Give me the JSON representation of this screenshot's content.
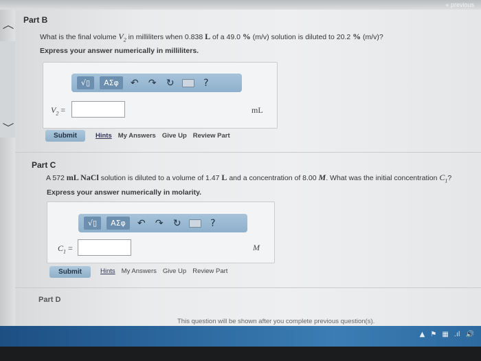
{
  "nav": {
    "previous_link": "« previous"
  },
  "partB": {
    "label": "Part B",
    "q_pre": "What is the final volume ",
    "q_var_main": "V",
    "q_var_sub": "2",
    "q_mid1": " in milliliters when 0.838 ",
    "q_unit_L": "L",
    "q_mid2": " of a 49.0 ",
    "q_pct1": "%",
    "q_mid3": " (m/v) solution is diluted to 20.2 ",
    "q_pct2": "%",
    "q_end": " (m/v)?",
    "instruction": "Express your answer numerically in milliliters.",
    "toolbar": {
      "template_icon": "√▯",
      "greek": "ΑΣφ",
      "undo": "↶",
      "redo": "↷",
      "reset": "↻",
      "help": "?"
    },
    "answer_var_main": "V",
    "answer_var_sub": "2",
    "answer_eq": " =",
    "answer_value": "",
    "unit": "mL",
    "submit": "Submit",
    "links": {
      "hints": "Hints",
      "my_answers": "My Answers",
      "give_up": "Give Up",
      "review_part": "Review Part"
    }
  },
  "partC": {
    "label": "Part C",
    "q_pre": "A 572 ",
    "q_unit_mL": "mL",
    "q_nacl": " NaCl",
    "q_mid1": " solution is diluted to a volume of 1.47 ",
    "q_unit_L": "L",
    "q_mid2": " and a concentration of 8.00 ",
    "q_unit_M": "M",
    "q_mid3": ". What was the initial concentration ",
    "q_var_main": "C",
    "q_var_sub": "1",
    "q_end": "?",
    "instruction": "Express your answer numerically in molarity.",
    "toolbar": {
      "template_icon": "√▯",
      "greek": "ΑΣφ",
      "undo": "↶",
      "redo": "↷",
      "reset": "↻",
      "help": "?"
    },
    "answer_var_main": "C",
    "answer_var_sub": "1",
    "answer_eq": " =",
    "answer_value": "",
    "unit": "M",
    "submit": "Submit",
    "links": {
      "hints": "Hints",
      "my_answers": "My Answers",
      "give_up": "Give Up",
      "review_part": "Review Part"
    }
  },
  "partD": {
    "label": "Part D",
    "notice": "This question will be shown after you complete previous question(s)."
  },
  "tray": {
    "icons": [
      "▲",
      "⚑",
      "▦",
      ".ıl",
      "🔊"
    ]
  },
  "colors": {
    "toolbar": "#9bbad3",
    "taskbar": "#2d6aa0",
    "submit": "#9ebcd3"
  }
}
